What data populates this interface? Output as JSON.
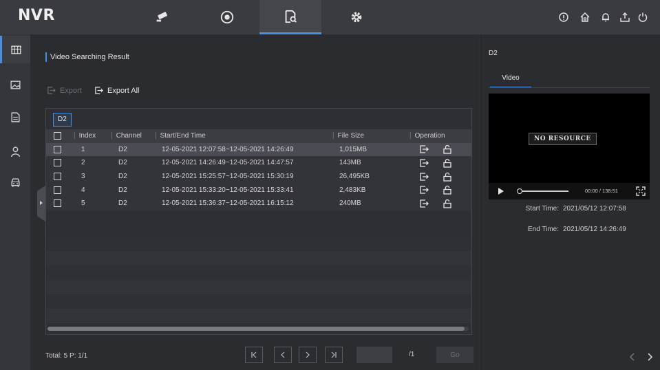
{
  "app": {
    "logo": "NVR"
  },
  "top_nav": [
    {
      "name": "live-view",
      "icon": "camera-icon",
      "active": false
    },
    {
      "name": "playback",
      "icon": "playback-icon",
      "active": false
    },
    {
      "name": "file-search",
      "icon": "file-search-icon",
      "active": true
    },
    {
      "name": "configuration",
      "icon": "gear-icon",
      "active": false
    }
  ],
  "top_right_icons": [
    "info-icon",
    "home-icon",
    "bell-icon",
    "export-icon",
    "power-icon"
  ],
  "sidebar": [
    {
      "icon": "video-grid-icon",
      "active": true
    },
    {
      "icon": "picture-icon",
      "active": false
    },
    {
      "icon": "document-icon",
      "active": false
    },
    {
      "icon": "person-icon",
      "active": false
    },
    {
      "icon": "vehicle-icon",
      "active": false
    }
  ],
  "main": {
    "section_title": "Video Searching Result",
    "export_label": "Export",
    "export_all_label": "Export All",
    "camera_tab": "D2",
    "table": {
      "headers": [
        "Index",
        "Channel",
        "Start/End Time",
        "File Size",
        "Operation"
      ],
      "rows": [
        {
          "index": "1",
          "channel": "D2",
          "time": "12-05-2021 12:07:58~12-05-2021 14:26:49",
          "size": "1,015MB",
          "selected": true
        },
        {
          "index": "2",
          "channel": "D2",
          "time": "12-05-2021 14:26:49~12-05-2021 14:47:57",
          "size": "143MB",
          "selected": false
        },
        {
          "index": "3",
          "channel": "D2",
          "time": "12-05-2021 15:25:57~12-05-2021 15:30:19",
          "size": "26,495KB",
          "selected": false
        },
        {
          "index": "4",
          "channel": "D2",
          "time": "12-05-2021 15:33:20~12-05-2021 15:33:41",
          "size": "2,483KB",
          "selected": false
        },
        {
          "index": "5",
          "channel": "D2",
          "time": "12-05-2021 15:36:37~12-05-2021 16:15:12",
          "size": "240MB",
          "selected": false
        }
      ]
    },
    "footer": {
      "total": "Total: 5 P: 1/1",
      "page_input_value": "",
      "page_total": "/1",
      "go_label": "Go"
    }
  },
  "preview": {
    "camera": "D2",
    "tab": "Video",
    "no_resource": "NO RESOURCE",
    "timecode": "00:00 / 138:51",
    "start_label": "Start Time:",
    "start_value": "2021/05/12 12:07:58",
    "end_label": "End Time:",
    "end_value": "2021/05/12 14:26:49"
  },
  "colors": {
    "accent": "#4a8fe0",
    "background": "#2e2f33",
    "selected_row": "#4b4c53"
  }
}
